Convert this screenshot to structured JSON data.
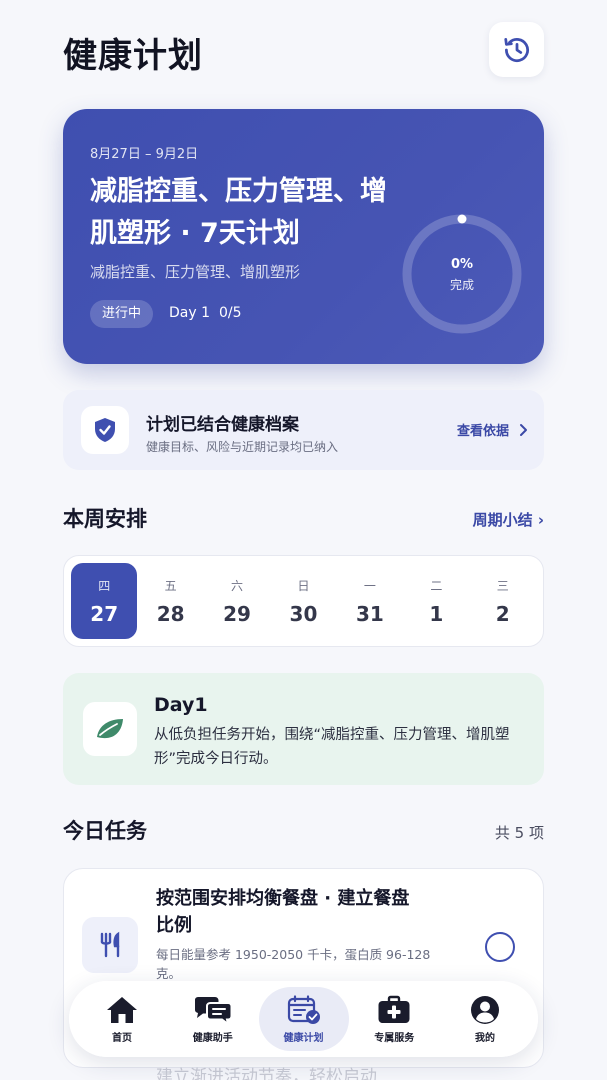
{
  "page": {
    "title": "健康计划"
  },
  "plan": {
    "date_range": "8月27日 – 9月2日",
    "title": "减脂控重、压力管理、增肌塑形 · 7天计划",
    "subtitle": "减脂控重、压力管理、增肌塑形",
    "status": "进行中",
    "day": "Day 1",
    "progress_text": "0/5",
    "percent_text": "0%",
    "percent_value": 0,
    "complete_label": "完成"
  },
  "notice": {
    "title": "计划已结合健康档案",
    "desc": "健康目标、风险与近期记录均已纳入",
    "link": "查看依据"
  },
  "week": {
    "title": "本周安排",
    "summary_link": "周期小结 ›",
    "days": [
      {
        "weekday": "四",
        "date": "27"
      },
      {
        "weekday": "五",
        "date": "28"
      },
      {
        "weekday": "六",
        "date": "29"
      },
      {
        "weekday": "日",
        "date": "30"
      },
      {
        "weekday": "一",
        "date": "31"
      },
      {
        "weekday": "二",
        "date": "1"
      },
      {
        "weekday": "三",
        "date": "2"
      }
    ]
  },
  "day_card": {
    "title": "Day1",
    "desc": "从低负担任务开始，围绕“减脂控重、压力管理、增肌塑形”完成今日行动。"
  },
  "tasks": {
    "title": "今日任务",
    "count": "共 5 项",
    "items": [
      {
        "name": "按范围安排均衡餐盘 · 建立餐盘比例",
        "desc": "每日能量参考 1950-2050 千卡，蛋白质 96-128 克。"
      }
    ],
    "next_peek": "建立渐进活动节奏，轻松启动"
  },
  "nav": {
    "items": [
      {
        "label": "首页"
      },
      {
        "label": "健康助手"
      },
      {
        "label": "健康计划"
      },
      {
        "label": "专属服务"
      },
      {
        "label": "我的"
      }
    ]
  },
  "colors": {
    "accent": "#3f4fb0",
    "day_card_bg": "#e8f4ee",
    "leaf": "#3f8a6a"
  }
}
